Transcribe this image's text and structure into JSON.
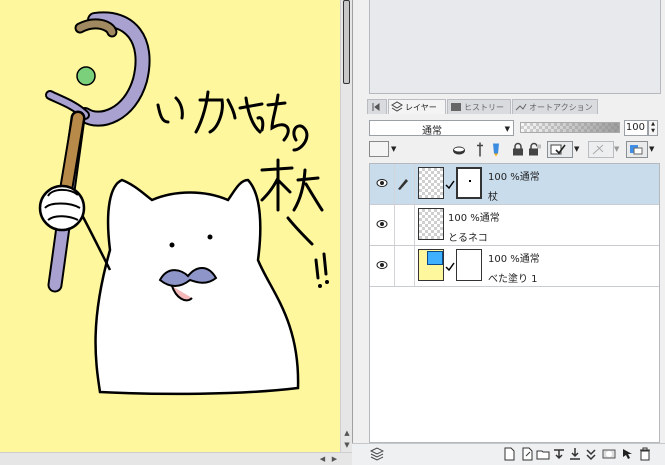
{
  "canvas": {
    "handwritten_text": "いかずちの杖ー!!"
  },
  "tabs": [
    {
      "label": "レイヤー",
      "icon": "layer-stack-icon",
      "active": true
    },
    {
      "label": "ヒストリー",
      "icon": "history-icon",
      "active": false
    },
    {
      "label": "オートアクション",
      "icon": "auto-action-icon",
      "active": false
    }
  ],
  "blend_mode": {
    "value": "通常"
  },
  "opacity": {
    "value": "100"
  },
  "layers": [
    {
      "line1": "100 %通常",
      "line2": "杖",
      "selected": true,
      "visible": true
    },
    {
      "line1": "100 %通常",
      "line2": "とるネコ",
      "selected": false,
      "visible": true
    },
    {
      "line1": "100 %通常",
      "line2": "べた塗り 1",
      "selected": false,
      "visible": true
    }
  ],
  "colors": {
    "canvas_bg": "#fff79e",
    "staff": "#a9a2d0",
    "staff_grip": "#b88a4a",
    "orb": "#7bd07b",
    "mustache": "#8e96c9",
    "selected_row": "#c9dcec",
    "fill_layer_yellow": "#fff79e",
    "fill_layer_blue": "#3fb0ff"
  }
}
